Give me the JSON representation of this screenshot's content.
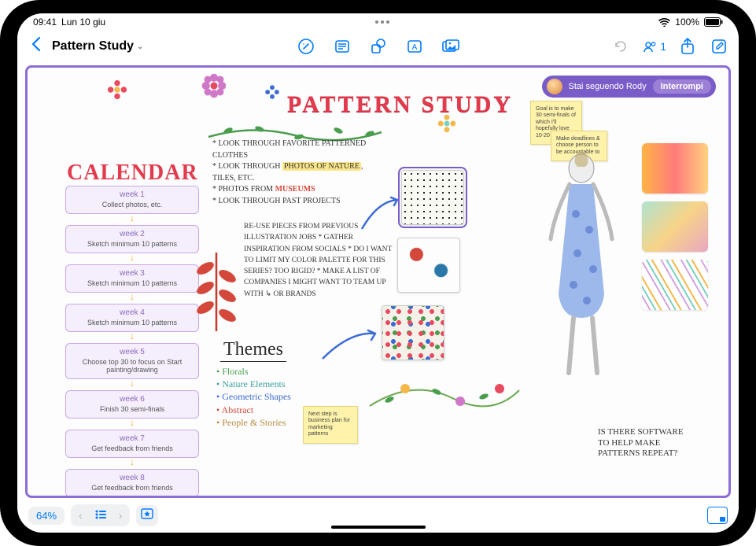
{
  "status": {
    "time": "09:41",
    "date": "Lun 10 giu",
    "battery": "100%"
  },
  "toolbar": {
    "board_title": "Pattern Study",
    "collab_count": "1"
  },
  "follow": {
    "text": "Stai seguendo Rody",
    "stop": "Interrompi"
  },
  "canvas": {
    "main_title": "PATTERN STUDY",
    "calendar_heading": "CALENDAR",
    "weeks": [
      {
        "title": "week 1",
        "body": "Collect photos, etc."
      },
      {
        "title": "week 2",
        "body": "Sketch minimum 10 patterns"
      },
      {
        "title": "week 3",
        "body": "Sketch minimum 10 patterns"
      },
      {
        "title": "week 4",
        "body": "Sketch minimum 10 patterns"
      },
      {
        "title": "week 5",
        "body": "Choose top 30 to focus on  Start painting/drawing"
      },
      {
        "title": "week 6",
        "body": "Finish 30 semi-finals"
      },
      {
        "title": "week 7",
        "body": "Get feedback from friends"
      },
      {
        "title": "week 8",
        "body": "Get feedback from friends"
      }
    ],
    "notes_a": [
      "LOOK THROUGH FAVORITE PATTERNED CLOTHES",
      "LOOK THROUGH PHOTOS OF NATURE, TILES, ETC.",
      "PHOTOS FROM MUSEUMS",
      "LOOK THROUGH PAST PROJECTS"
    ],
    "notes_b": [
      "RE-USE PIECES FROM PREVIOUS ILLUSTRATION JOBS",
      "* GATHER INSPIRATION FROM SOCIALS",
      "* DO I WANT TO LIMIT MY COLOR PALETTE FOR THIS SERIES? TOO RIGID?",
      "* MAKE A LIST OF COMPANIES I MIGHT WANT TO TEAM UP WITH ↳ OR BRANDS"
    ],
    "themes_heading": "Themes",
    "themes": [
      "Florals",
      "Nature Elements",
      "Geometric Shapes",
      "Abstract",
      "People & Stories"
    ],
    "sticky1": "Next step is business plan for marketing patterns",
    "sticky2": "Goal is to make 30 semi-finals of which I'll hopefully love 10-20",
    "sticky3": "Make deadlines & choose person to be accountable to",
    "question": "IS THERE SOFTWARE TO HELP MAKE PATTERNS REPEAT?"
  },
  "bottom": {
    "zoom": "64%"
  }
}
